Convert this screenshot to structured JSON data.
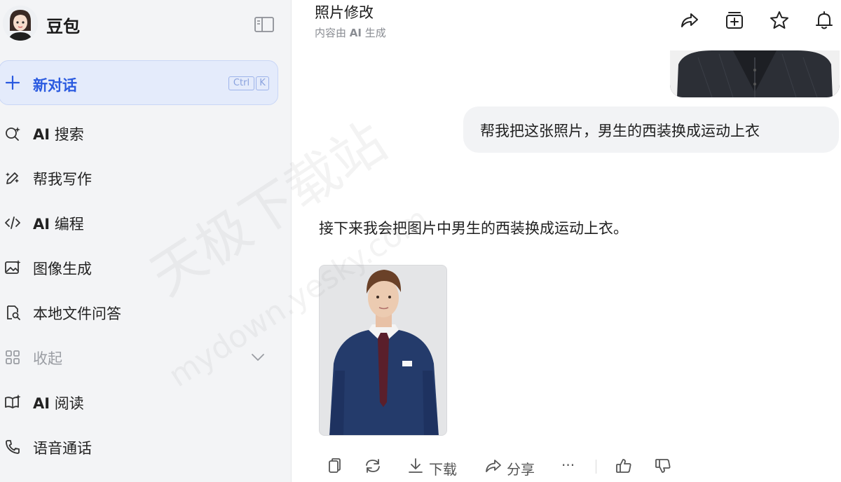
{
  "app": {
    "name": "豆包"
  },
  "sidebar": {
    "new_chat": {
      "label": "新对话",
      "shortcut_ctrl": "Ctrl",
      "shortcut_key": "K"
    },
    "items": [
      {
        "prefix": "AI",
        "label": " 搜索",
        "icon": "ai-search-icon"
      },
      {
        "prefix": "",
        "label": "帮我写作",
        "icon": "pen-sparkle-icon"
      },
      {
        "prefix": "AI",
        "label": " 编程",
        "icon": "code-icon"
      },
      {
        "prefix": "",
        "label": "图像生成",
        "icon": "image-sparkle-icon"
      },
      {
        "prefix": "",
        "label": "本地文件问答",
        "icon": "file-search-icon"
      },
      {
        "prefix": "",
        "label": "收起",
        "icon": "apps-icon"
      },
      {
        "prefix": "AI",
        "label": " 阅读",
        "icon": "book-sparkle-icon"
      },
      {
        "prefix": "",
        "label": "语音通话",
        "icon": "phone-icon"
      }
    ]
  },
  "header": {
    "title": "照片修改",
    "subtitle_before": "内容由 ",
    "subtitle_ai": "AI",
    "subtitle_after": " 生成"
  },
  "chat": {
    "user_message": "帮我把这张照片，男生的西装换成运动上衣",
    "assistant_text": "接下来我会把图片中男生的西装换成运动上衣。",
    "actions": {
      "download": "下载",
      "share": "分享",
      "more": "···"
    }
  },
  "watermark": {
    "main": "天极下载站",
    "sub": "mydown.yesky.com"
  },
  "colors": {
    "accent": "#2a5ae0",
    "sidebar_bg": "#f3f4f6",
    "new_chat_bg": "#e4ebfb"
  }
}
